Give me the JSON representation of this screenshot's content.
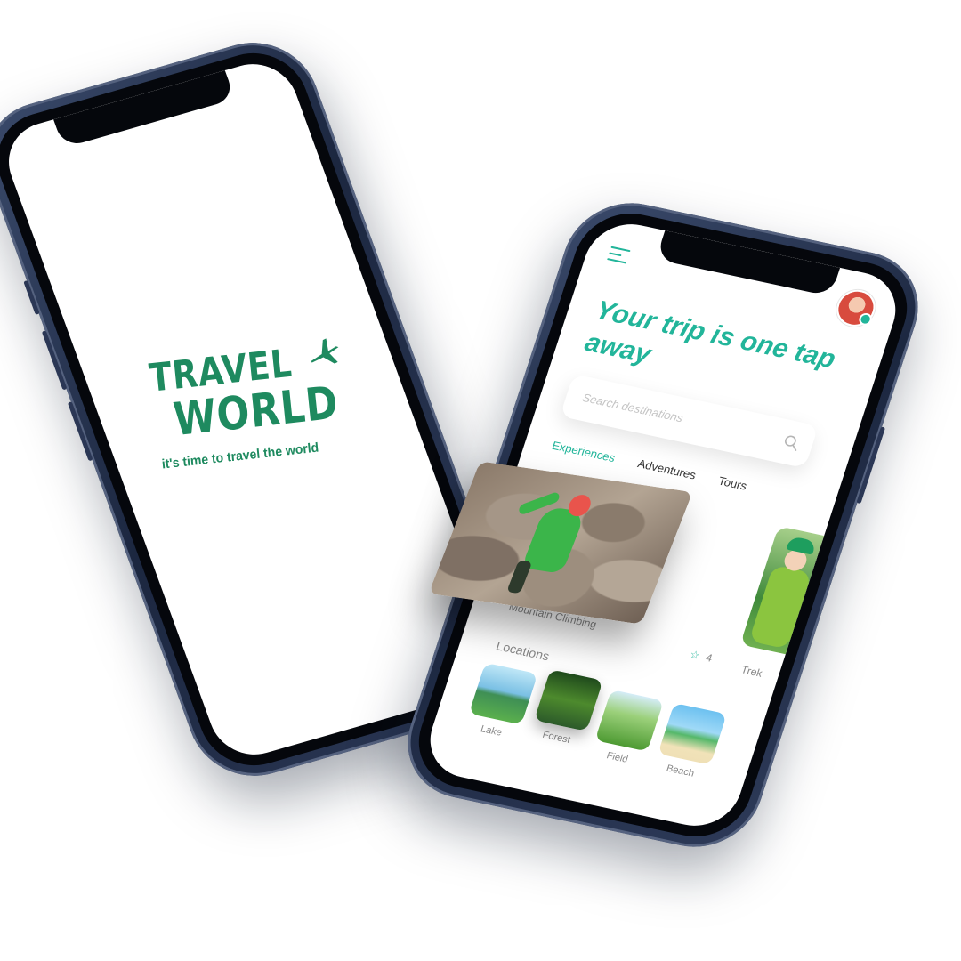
{
  "splash": {
    "logo_line1": "TRAVEL",
    "logo_line2": "WORLD",
    "tagline": "it's time to travel the world",
    "brand_color": "#1e8a5f"
  },
  "app": {
    "accent_color": "#22b59a",
    "hero_title": "Your trip is one tap away",
    "search_placeholder": "Search destinations",
    "tabs": [
      {
        "label": "Experiences",
        "active": true
      },
      {
        "label": "Adventures",
        "active": false
      },
      {
        "label": "Tours",
        "active": false
      }
    ],
    "featured_card_label": "Mountain Climbing",
    "rating": "4",
    "side_card_label": "Trek",
    "locations_title": "Locations",
    "locations": [
      {
        "name": "Lake"
      },
      {
        "name": "Forest"
      },
      {
        "name": "Field"
      },
      {
        "name": "Beach"
      }
    ]
  }
}
